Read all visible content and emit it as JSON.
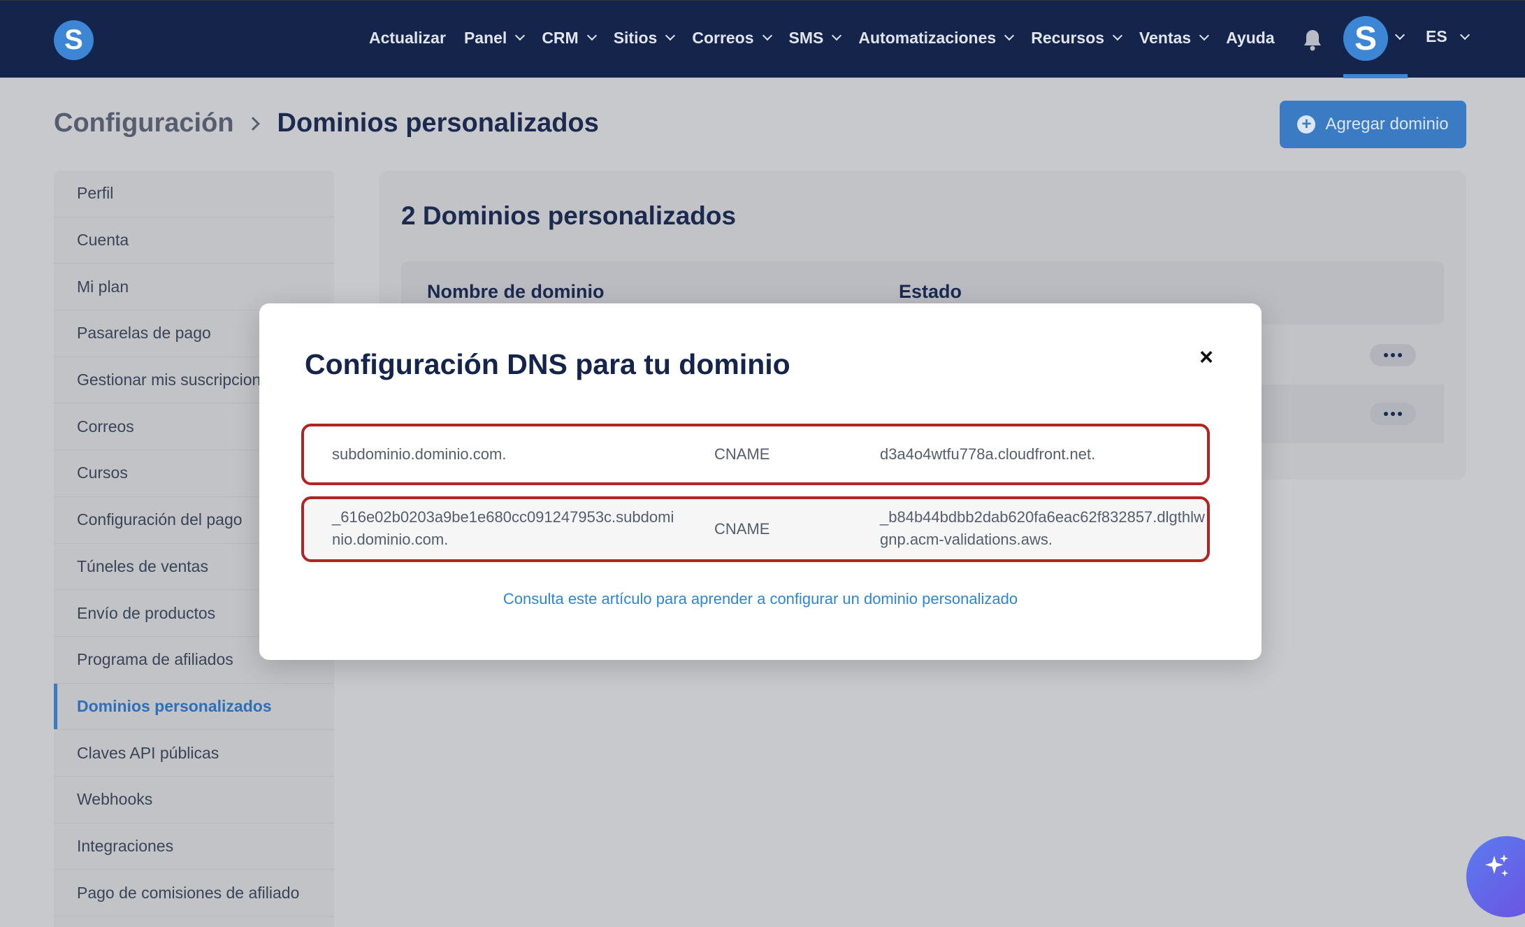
{
  "app": {
    "logo_letter": "S",
    "accent": "#3d86d6",
    "nav_bg": "#14244a"
  },
  "nav": {
    "items": [
      {
        "label": "Actualizar",
        "dropdown": false
      },
      {
        "label": "Panel",
        "dropdown": true
      },
      {
        "label": "CRM",
        "dropdown": true
      },
      {
        "label": "Sitios",
        "dropdown": true
      },
      {
        "label": "Correos",
        "dropdown": true
      },
      {
        "label": "SMS",
        "dropdown": true
      },
      {
        "label": "Automatizaciones",
        "dropdown": true
      },
      {
        "label": "Recursos",
        "dropdown": true
      },
      {
        "label": "Ventas",
        "dropdown": true
      },
      {
        "label": "Ayuda",
        "dropdown": false
      }
    ],
    "bell_icon": "bell-icon",
    "avatar_letter": "S",
    "language": "ES"
  },
  "header": {
    "breadcrumb_parent": "Configuración",
    "breadcrumb_current": "Dominios personalizados",
    "add_button_label": "Agregar dominio"
  },
  "sidebar": {
    "items": [
      {
        "label": "Perfil"
      },
      {
        "label": "Cuenta"
      },
      {
        "label": "Mi plan"
      },
      {
        "label": "Pasarelas de pago"
      },
      {
        "label": "Gestionar mis suscripciones"
      },
      {
        "label": "Correos"
      },
      {
        "label": "Cursos"
      },
      {
        "label": "Configuración del pago"
      },
      {
        "label": "Túneles de ventas"
      },
      {
        "label": "Envío de productos"
      },
      {
        "label": "Programa de afiliados"
      },
      {
        "label": "Dominios personalizados",
        "active": true
      },
      {
        "label": "Claves API públicas"
      },
      {
        "label": "Webhooks"
      },
      {
        "label": "Integraciones"
      },
      {
        "label": "Pago de comisiones de afiliado"
      }
    ]
  },
  "main": {
    "title": "2 Dominios personalizados",
    "columns": [
      "Nombre de dominio",
      "Estado"
    ]
  },
  "modal": {
    "title": "Configuración DNS para tu dominio",
    "records": [
      {
        "host": "subdominio.dominio.com.",
        "type": "CNAME",
        "value": "d3a4o4wtfu778a.cloudfront.net."
      },
      {
        "host_line1": "_616e02b0203a9be1e680cc091247953c.subdomi",
        "host_line2": "nio.dominio.com.",
        "type": "CNAME",
        "value_line1": "_b84b44bdbb2dab620fa6eac62f832857.dlgthlw",
        "value_line2": "gnp.acm-validations.aws."
      }
    ],
    "help_link": "Consulta este artículo para aprender a configurar un dominio personalizado",
    "highlight_color": "#b02424"
  }
}
